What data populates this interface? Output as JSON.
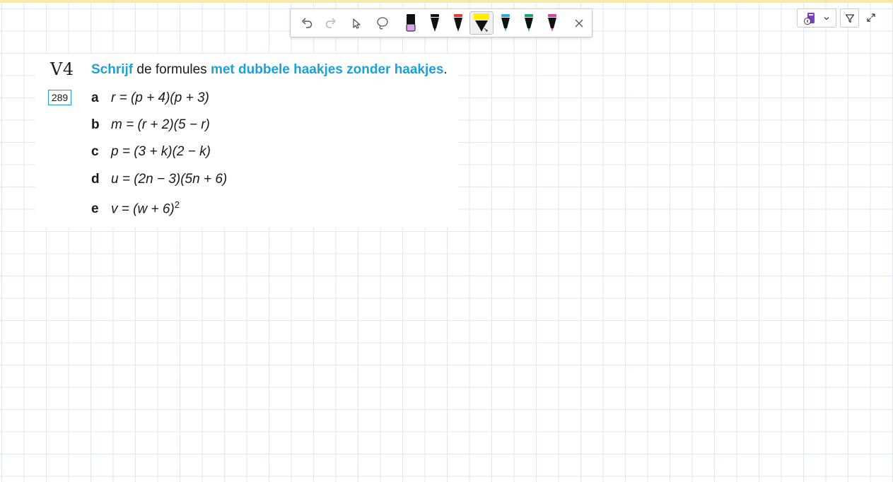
{
  "toolbar": {
    "tools": [
      {
        "icon": "undo-icon"
      },
      {
        "icon": "redo-icon"
      },
      {
        "icon": "pointer-icon"
      },
      {
        "icon": "lasso-icon"
      },
      {
        "icon": "pen-icon",
        "color": "#111111",
        "tip": "#d9a6e6"
      },
      {
        "icon": "pen-icon",
        "color": "#111111",
        "tip": "#111111"
      },
      {
        "icon": "pen-icon",
        "color": "#e23b3b",
        "tip": "#111111"
      },
      {
        "icon": "highlighter-icon",
        "color": "#ffee00",
        "tip": "#111111",
        "active": true
      },
      {
        "icon": "pen-icon",
        "color": "#2aa7e0",
        "tip": "#111111"
      },
      {
        "icon": "pen-icon",
        "color": "#1aa36b",
        "tip": "#111111"
      },
      {
        "icon": "pen-icon",
        "color": "#d63fae",
        "tip": "#111111"
      },
      {
        "icon": "close-icon"
      }
    ]
  },
  "right_tools": [
    "notebook-dropdown-icon",
    "filter-icon",
    "expand-icon"
  ],
  "exercise": {
    "number": "V4",
    "badge": "289",
    "instruction": {
      "part1": "Schrijf",
      "part2": " de formules ",
      "part3": "met dubbele haakjes zonder haakjes",
      "part4": "."
    },
    "items": [
      {
        "letter": "a",
        "formula": "r = (p + 4)(p + 3)"
      },
      {
        "letter": "b",
        "formula": "m = (r + 2)(5 − r)"
      },
      {
        "letter": "c",
        "formula": "p = (3 + k)(2 − k)"
      },
      {
        "letter": "d",
        "formula": "u = (2n − 3)(5n + 6)"
      },
      {
        "letter": "e",
        "formula": "v = (w + 6)",
        "sup": "2"
      }
    ]
  },
  "colors": {
    "accent": "#1e9fd6",
    "grid": "#dfe7f2"
  }
}
